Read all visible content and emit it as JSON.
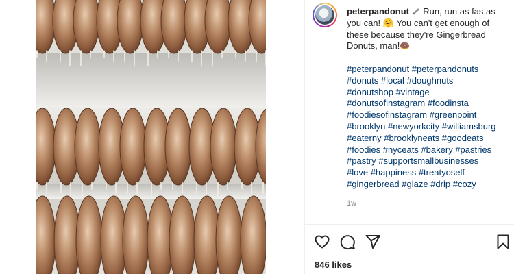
{
  "post": {
    "username": "peterpandonut",
    "caption_text": "Run, run as fas as you can! 🤗 You can't get enough of these because they're Gingerbread Donuts, man!",
    "caption_lead_icon": "donut-tool-icon",
    "caption_end_emoji": "🍩",
    "hashtag_lines": [
      [
        "#peterpandonut",
        "#peterpandonuts"
      ],
      [
        "#donuts",
        "#local",
        "#doughnuts"
      ],
      [
        "#donutshop",
        "#vintage"
      ],
      [
        "#donutsofinstagram",
        "#foodinsta"
      ],
      [
        "#foodiesofinstagram",
        "#greenpoint"
      ],
      [
        "#brooklyn",
        "#newyorkcity",
        "#williamsburg"
      ],
      [
        "#eaterny",
        "#brooklyneats",
        "#goodeats"
      ],
      [
        "#foodies",
        "#nyceats",
        "#bakery",
        "#pastries"
      ],
      [
        "#pastry",
        "#supportsmallbusinesses"
      ],
      [
        "#love",
        "#happiness",
        "#treatyoself"
      ],
      [
        "#gingerbread",
        "#glaze",
        "#drip",
        "#cozy"
      ]
    ],
    "timestamp": "1w",
    "likes_text": "846 likes"
  },
  "actions": {
    "icons": [
      "heart-icon",
      "comment-icon",
      "share-icon",
      "bookmark-icon"
    ]
  },
  "colors": {
    "hashtag": "#00376b",
    "text": "#262626",
    "muted": "#8e8e8e"
  }
}
